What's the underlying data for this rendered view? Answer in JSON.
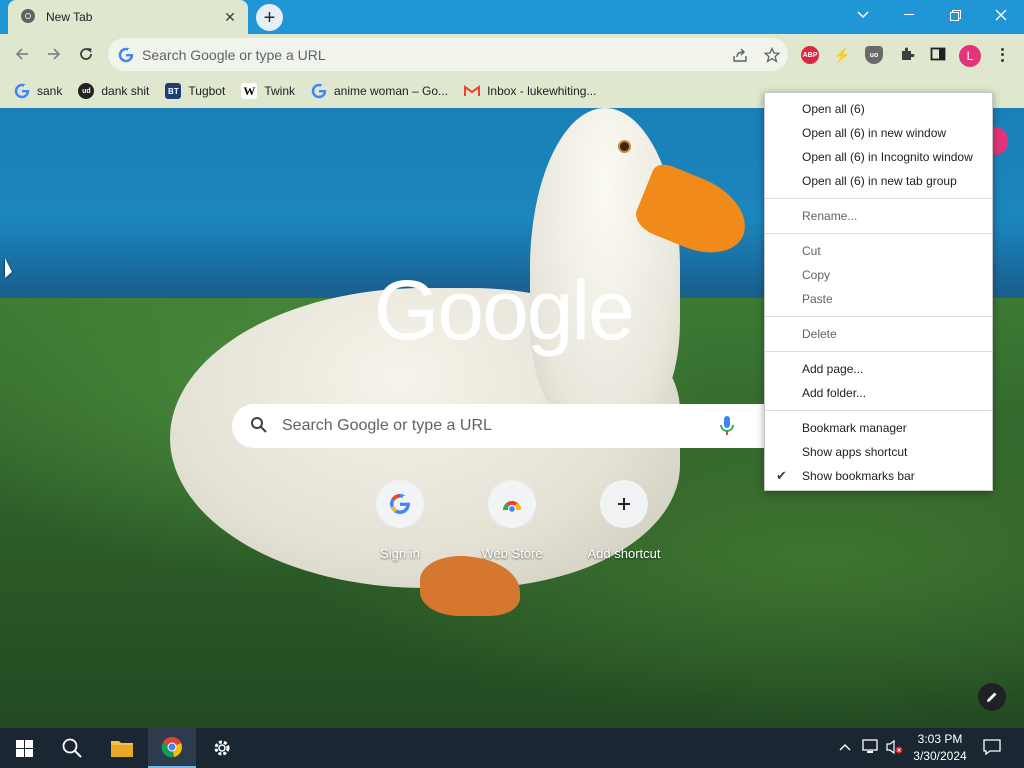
{
  "browser": {
    "tab_title": "New Tab",
    "omnibox_placeholder": "Search Google or type a URL",
    "profile_initial": "L"
  },
  "extensions": [
    {
      "name": "adblock-plus-icon",
      "label": "ABP",
      "color": "#e0263f"
    },
    {
      "name": "extension-lightning-icon",
      "label": "⚡",
      "color": "#f4b400"
    },
    {
      "name": "ublock-origin-icon",
      "label": "uo",
      "color": "#6a6a6a"
    }
  ],
  "bookmarks": [
    {
      "name": "bookmark-sank",
      "label": "sank",
      "icon": "google-icon"
    },
    {
      "name": "bookmark-dank-shit",
      "label": "dank shit",
      "icon": "ud-icon"
    },
    {
      "name": "bookmark-tugbot",
      "label": "Tugbot",
      "icon": "bt-icon"
    },
    {
      "name": "bookmark-twink",
      "label": "Twink",
      "icon": "wikipedia-icon"
    },
    {
      "name": "bookmark-anime-woman",
      "label": "anime woman – Go...",
      "icon": "google-icon"
    },
    {
      "name": "bookmark-inbox",
      "label": "Inbox - lukewhiting...",
      "icon": "gmail-icon"
    }
  ],
  "ntp": {
    "logo_text": "Google",
    "search_placeholder": "Search Google or type a URL",
    "shortcuts": [
      {
        "name": "shortcut-sign-in",
        "label": "Sign in",
        "icon": "google-icon"
      },
      {
        "name": "shortcut-web-store",
        "label": "Web Store",
        "icon": "chrome-web-store-icon"
      },
      {
        "name": "shortcut-add",
        "label": "Add shortcut",
        "icon": "plus-icon"
      }
    ]
  },
  "context_menu": {
    "groups": [
      [
        {
          "name": "menu-open-all",
          "label": "Open all (6)",
          "enabled": true
        },
        {
          "name": "menu-open-all-new-window",
          "label": "Open all (6) in new window",
          "enabled": true
        },
        {
          "name": "menu-open-all-incognito",
          "label": "Open all (6) in Incognito window",
          "enabled": true
        },
        {
          "name": "menu-open-all-tab-group",
          "label": "Open all (6) in new tab group",
          "enabled": true
        }
      ],
      [
        {
          "name": "menu-rename",
          "label": "Rename...",
          "enabled": false
        }
      ],
      [
        {
          "name": "menu-cut",
          "label": "Cut",
          "enabled": false
        },
        {
          "name": "menu-copy",
          "label": "Copy",
          "enabled": false
        },
        {
          "name": "menu-paste",
          "label": "Paste",
          "enabled": false
        }
      ],
      [
        {
          "name": "menu-delete",
          "label": "Delete",
          "enabled": false
        }
      ],
      [
        {
          "name": "menu-add-page",
          "label": "Add page...",
          "enabled": true
        },
        {
          "name": "menu-add-folder",
          "label": "Add folder...",
          "enabled": true
        }
      ],
      [
        {
          "name": "menu-bookmark-manager",
          "label": "Bookmark manager",
          "enabled": true
        },
        {
          "name": "menu-show-apps-shortcut",
          "label": "Show apps shortcut",
          "enabled": true
        },
        {
          "name": "menu-show-bookmarks-bar",
          "label": "Show bookmarks bar",
          "enabled": true,
          "checked": true
        }
      ]
    ]
  },
  "taskbar": {
    "time": "3:03 PM",
    "date": "3/30/2024"
  },
  "colors": {
    "titlebar": "#2196d6",
    "toolbar": "#dfe7ce",
    "profile": "#e2347a",
    "taskbar": "#1b2633"
  }
}
